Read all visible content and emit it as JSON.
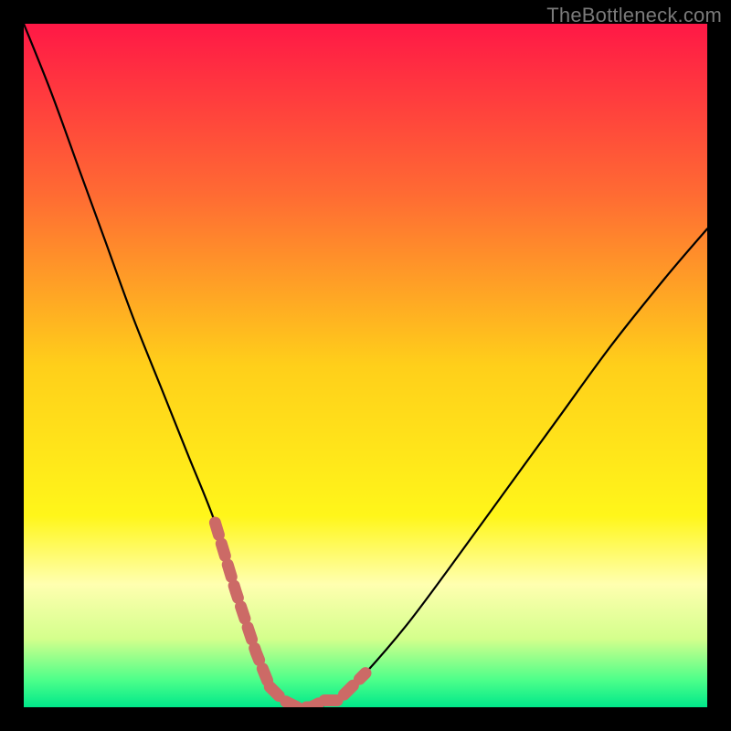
{
  "watermark": "TheBottleneck.com",
  "colors": {
    "background_black": "#000000",
    "curve_stroke": "#000000",
    "marker_stroke": "#cc6a66",
    "watermark_text": "#7a7a7a"
  },
  "chart_data": {
    "type": "line",
    "title": "",
    "xlabel": "",
    "ylabel": "",
    "xlim": [
      0,
      100
    ],
    "ylim": [
      0,
      100
    ],
    "gradient_stops": [
      {
        "offset": 0.0,
        "color": "#ff1846"
      },
      {
        "offset": 0.25,
        "color": "#ff6b33"
      },
      {
        "offset": 0.5,
        "color": "#ffcf1a"
      },
      {
        "offset": 0.72,
        "color": "#fff61a"
      },
      {
        "offset": 0.82,
        "color": "#ffffb0"
      },
      {
        "offset": 0.9,
        "color": "#d4ff8c"
      },
      {
        "offset": 0.96,
        "color": "#4dff8a"
      },
      {
        "offset": 1.0,
        "color": "#00e88a"
      }
    ],
    "series": [
      {
        "name": "bottleneck-curve",
        "x": [
          0,
          4,
          8,
          12,
          16,
          20,
          24,
          28,
          31,
          34,
          36,
          38,
          40,
          42,
          46,
          50,
          56,
          62,
          70,
          78,
          86,
          94,
          100
        ],
        "y": [
          100,
          90,
          79,
          68,
          57,
          47,
          37,
          27,
          17,
          8,
          3,
          1,
          0,
          0,
          1,
          5,
          12,
          20,
          31,
          42,
          53,
          63,
          70
        ]
      }
    ],
    "marker_segments": [
      {
        "x": [
          28,
          31,
          34,
          36
        ],
        "y": [
          27,
          17,
          8,
          3
        ]
      },
      {
        "x": [
          36,
          38,
          40,
          42,
          44
        ],
        "y": [
          3,
          1,
          0,
          0,
          1
        ]
      },
      {
        "x": [
          44,
          46,
          48,
          50
        ],
        "y": [
          1,
          1,
          3,
          5
        ]
      }
    ],
    "annotations": []
  }
}
